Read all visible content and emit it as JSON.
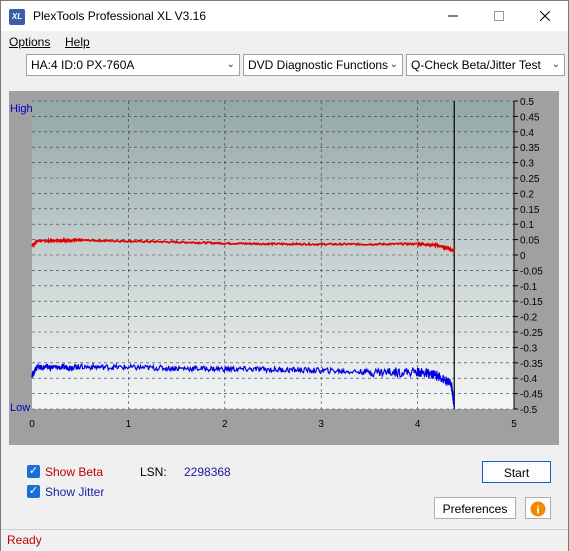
{
  "window": {
    "title": "PlexTools Professional XL V3.16",
    "icon_label": "XL"
  },
  "menu": [
    {
      "label": "Options",
      "underline": "O"
    },
    {
      "label": "Help",
      "underline": "H"
    }
  ],
  "toolbar": {
    "drive": "HA:4 ID:0  PX-760A",
    "function": "DVD Diagnostic Functions",
    "test": "Q-Check Beta/Jitter Test"
  },
  "chart_data": {
    "type": "line",
    "x_ticks": [
      "0",
      "1",
      "2",
      "3",
      "4",
      "5"
    ],
    "xlim": [
      0,
      5
    ],
    "ylim": [
      -0.5,
      0.5
    ],
    "y_ticks": [
      "0.5",
      "0.45",
      "0.4",
      "0.35",
      "0.3",
      "0.25",
      "0.2",
      "0.15",
      "0.1",
      "0.05",
      "0",
      "-0.05",
      "-0.1",
      "-0.15",
      "-0.2",
      "-0.25",
      "-0.3",
      "-0.35",
      "-0.4",
      "-0.45",
      "-0.5"
    ],
    "left_labels": {
      "high": "High",
      "low": "Low"
    },
    "end_marker_x": 4.38,
    "series": [
      {
        "name": "Beta",
        "color": "#e00000",
        "x": [
          0.0,
          0.05,
          0.3,
          0.5,
          1.0,
          1.5,
          2.0,
          2.5,
          3.0,
          3.5,
          4.0,
          4.2,
          4.35,
          4.38
        ],
        "y": [
          0.03,
          0.045,
          0.047,
          0.048,
          0.045,
          0.042,
          0.038,
          0.036,
          0.035,
          0.035,
          0.036,
          0.032,
          0.018,
          0.01
        ]
      },
      {
        "name": "Jitter",
        "color": "#0000e0",
        "x": [
          0.0,
          0.05,
          0.3,
          0.5,
          1.0,
          1.5,
          2.0,
          2.5,
          3.0,
          3.5,
          4.0,
          4.2,
          4.35,
          4.38
        ],
        "y": [
          -0.39,
          -0.365,
          -0.365,
          -0.363,
          -0.365,
          -0.368,
          -0.37,
          -0.372,
          -0.375,
          -0.38,
          -0.38,
          -0.39,
          -0.42,
          -0.49
        ]
      }
    ]
  },
  "controls": {
    "show_beta": {
      "label": "Show Beta",
      "checked": true,
      "color": "#c00000"
    },
    "show_jitter": {
      "label": "Show Jitter",
      "checked": true,
      "color": "#1a1aa8"
    },
    "lsn_label": "LSN:",
    "lsn_value": "2298368",
    "start_button": "Start",
    "preferences_button": "Preferences"
  },
  "status": {
    "text": "Ready"
  }
}
